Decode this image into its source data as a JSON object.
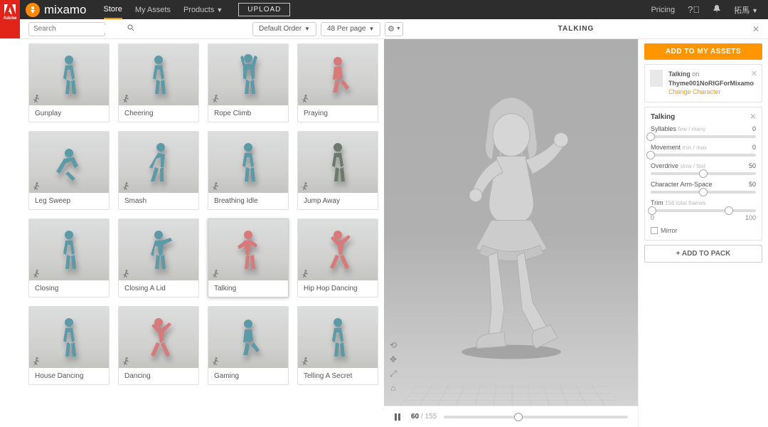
{
  "adobe_label": "Adobe",
  "brand": "mixamo",
  "nav": {
    "store": "Store",
    "assets": "My Assets",
    "products": "Products",
    "upload": "UPLOAD",
    "pricing": "Pricing",
    "user": "拓馬"
  },
  "search": {
    "placeholder": "Search"
  },
  "toolbar": {
    "sort": "Default Order",
    "perpage": "48 Per page"
  },
  "panel_title": "TALKING",
  "cards": [
    {
      "label": "Gunplay",
      "color": "teal",
      "pose": "stand"
    },
    {
      "label": "Cheering",
      "color": "teal",
      "pose": "stand"
    },
    {
      "label": "Rope Climb",
      "color": "teal",
      "pose": "climb"
    },
    {
      "label": "Praying",
      "color": "pink",
      "pose": "kneel"
    },
    {
      "label": "Leg Sweep",
      "color": "teal",
      "pose": "crouch"
    },
    {
      "label": "Smash",
      "color": "teal",
      "pose": "lean"
    },
    {
      "label": "Breathing Idle",
      "color": "teal",
      "pose": "stand"
    },
    {
      "label": "Jump Away",
      "color": "camo",
      "pose": "stand"
    },
    {
      "label": "Closing",
      "color": "teal",
      "pose": "stand"
    },
    {
      "label": "Closing A Lid",
      "color": "teal",
      "pose": "reach"
    },
    {
      "label": "Talking",
      "color": "pink",
      "pose": "talk",
      "selected": true
    },
    {
      "label": "Hip Hop Dancing",
      "color": "pink",
      "pose": "dance"
    },
    {
      "label": "House Dancing",
      "color": "teal",
      "pose": "stand"
    },
    {
      "label": "Dancing",
      "color": "pink",
      "pose": "dance"
    },
    {
      "label": "Gaming",
      "color": "teal",
      "pose": "kneel"
    },
    {
      "label": "Telling A Secret",
      "color": "teal",
      "pose": "stand"
    }
  ],
  "frame": {
    "current": "60",
    "total": "155"
  },
  "cta": "ADD TO MY ASSETS",
  "asset": {
    "name": "Talking",
    "on": "on",
    "character": "Thyme001NoRIGForMixamo",
    "change": "Change Character"
  },
  "params": {
    "title": "Talking",
    "list": [
      {
        "label": "Syllables",
        "hint": "few / many",
        "value": "0",
        "pos": 0
      },
      {
        "label": "Movement",
        "hint": "min / max",
        "value": "0",
        "pos": 0
      },
      {
        "label": "Overdrive",
        "hint": "slow / fast",
        "value": "50",
        "pos": 50
      },
      {
        "label": "Character Arm-Space",
        "hint": "",
        "value": "50",
        "pos": 50
      }
    ],
    "trim": {
      "label": "Trim",
      "hint": "156 total frames",
      "start": "0",
      "end": "100"
    },
    "mirror": "Mirror"
  },
  "pack": "ADD TO PACK"
}
